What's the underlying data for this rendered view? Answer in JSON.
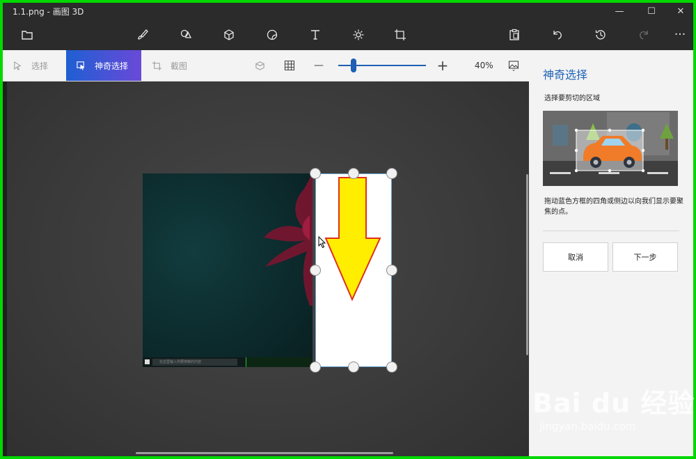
{
  "window": {
    "title": "1.1.png - 画图 3D",
    "min_glyph": "—",
    "max_glyph": "☐",
    "close_glyph": "✕"
  },
  "toolbar": {
    "left_icons": [
      "folder-icon"
    ],
    "center_icons": [
      "brush-icon",
      "2d-shapes-icon",
      "3d-shapes-icon",
      "stickers-icon",
      "text-icon",
      "effects-icon",
      "canvas-icon"
    ],
    "right_icons": [
      "paste-icon",
      "undo-icon",
      "history-icon",
      "redo-icon",
      "more-icon"
    ],
    "more_glyph": "···"
  },
  "subbar": {
    "select_label": "选择",
    "magic_select_label": "神奇选择",
    "crop_label": "截图",
    "zoom_label": "40%",
    "zoom_value_percent": 40,
    "minus_glyph": "—",
    "plus_glyph": "+"
  },
  "canvas": {
    "taskbar_search_text": "在这里输入你要搜索的内容"
  },
  "panel": {
    "title": "神奇选择",
    "subtitle": "选择要剪切的区域",
    "description": "拖动蓝色方框的四角或侧边以向我们显示要聚焦的点。",
    "cancel_label": "取消",
    "next_label": "下一步"
  },
  "watermark": {
    "brand": "Bai du 经验",
    "url": "jingyan.baidu.com"
  },
  "colors": {
    "accent": "#1f64b8",
    "frame": "#00d800",
    "arrow_fill": "#ffee00",
    "arrow_stroke": "#e0301e"
  }
}
